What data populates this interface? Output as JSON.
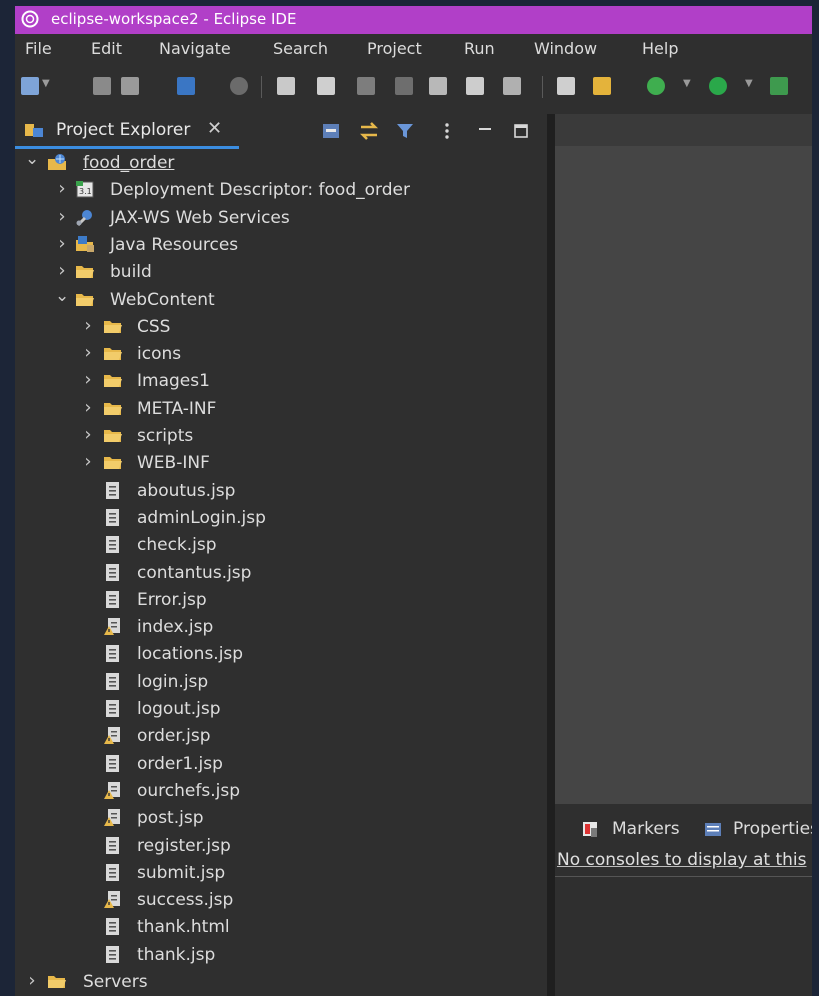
{
  "window": {
    "title": "eclipse-workspace2 - Eclipse IDE"
  },
  "menu": [
    {
      "key": "F",
      "rest": "ile"
    },
    {
      "key": "E",
      "rest": "dit"
    },
    {
      "key": "N",
      "rest": "avigate"
    },
    {
      "key": "Se",
      "rest": "a",
      "tail": "rch",
      "mode": "mid"
    },
    {
      "key": "P",
      "rest": "roject"
    },
    {
      "key": "R",
      "rest": "un"
    },
    {
      "key": "W",
      "rest": "indow"
    },
    {
      "key": "H",
      "rest": "elp"
    }
  ],
  "menu_labels": [
    "File",
    "Edit",
    "Navigate",
    "Search",
    "Project",
    "Run",
    "Window",
    "Help"
  ],
  "explorer": {
    "title": "Project Explorer",
    "close_glyph": "✕",
    "header_icons": [
      "collapse-all-icon",
      "link-with-editor-icon",
      "filter-icon",
      "view-menu-icon",
      "minimize-icon",
      "maximize-icon"
    ]
  },
  "tree": [
    {
      "label": "food_order",
      "depth": 0,
      "chev": "open",
      "icon": "project"
    },
    {
      "label": "Deployment Descriptor: food_order",
      "depth": 1,
      "chev": "closed",
      "icon": "descriptor"
    },
    {
      "label": "JAX-WS Web Services",
      "depth": 1,
      "chev": "closed",
      "icon": "webservices"
    },
    {
      "label": "Java Resources",
      "depth": 1,
      "chev": "closed",
      "icon": "javares"
    },
    {
      "label": "build",
      "depth": 1,
      "chev": "closed",
      "icon": "folder"
    },
    {
      "label": "WebContent",
      "depth": 1,
      "chev": "open",
      "icon": "folder"
    },
    {
      "label": "CSS",
      "depth": 2,
      "chev": "closed",
      "icon": "folder"
    },
    {
      "label": "icons",
      "depth": 2,
      "chev": "closed",
      "icon": "folder"
    },
    {
      "label": "Images1",
      "depth": 2,
      "chev": "closed",
      "icon": "folder"
    },
    {
      "label": "META-INF",
      "depth": 2,
      "chev": "closed",
      "icon": "folder"
    },
    {
      "label": "scripts",
      "depth": 2,
      "chev": "closed",
      "icon": "folder"
    },
    {
      "label": "WEB-INF",
      "depth": 2,
      "chev": "closed",
      "icon": "folder"
    },
    {
      "label": "aboutus.jsp",
      "depth": 2,
      "chev": "none",
      "icon": "file"
    },
    {
      "label": "adminLogin.jsp",
      "depth": 2,
      "chev": "none",
      "icon": "file"
    },
    {
      "label": "check.jsp",
      "depth": 2,
      "chev": "none",
      "icon": "file"
    },
    {
      "label": "contantus.jsp",
      "depth": 2,
      "chev": "none",
      "icon": "file"
    },
    {
      "label": "Error.jsp",
      "depth": 2,
      "chev": "none",
      "icon": "file"
    },
    {
      "label": "index.jsp",
      "depth": 2,
      "chev": "none",
      "icon": "file-warning"
    },
    {
      "label": "locations.jsp",
      "depth": 2,
      "chev": "none",
      "icon": "file"
    },
    {
      "label": "login.jsp",
      "depth": 2,
      "chev": "none",
      "icon": "file"
    },
    {
      "label": "logout.jsp",
      "depth": 2,
      "chev": "none",
      "icon": "file"
    },
    {
      "label": "order.jsp",
      "depth": 2,
      "chev": "none",
      "icon": "file-warning"
    },
    {
      "label": "order1.jsp",
      "depth": 2,
      "chev": "none",
      "icon": "file"
    },
    {
      "label": "ourchefs.jsp",
      "depth": 2,
      "chev": "none",
      "icon": "file-warning"
    },
    {
      "label": "post.jsp",
      "depth": 2,
      "chev": "none",
      "icon": "file-warning"
    },
    {
      "label": "register.jsp",
      "depth": 2,
      "chev": "none",
      "icon": "file"
    },
    {
      "label": "submit.jsp",
      "depth": 2,
      "chev": "none",
      "icon": "file"
    },
    {
      "label": "success.jsp",
      "depth": 2,
      "chev": "none",
      "icon": "file-warning"
    },
    {
      "label": "thank.html",
      "depth": 2,
      "chev": "none",
      "icon": "file"
    },
    {
      "label": "thank.jsp",
      "depth": 2,
      "chev": "none",
      "icon": "file"
    },
    {
      "label": "Servers",
      "depth": 0,
      "chev": "closed",
      "icon": "folder"
    }
  ],
  "bottom": {
    "tabs": [
      {
        "label": "Markers",
        "icon": "markers-icon"
      },
      {
        "label": "Properties",
        "icon": "properties-icon"
      }
    ],
    "message": "No consoles to display at this"
  },
  "colors": {
    "titlebar": "#b13fc8",
    "background": "#2f2f2f",
    "editor": "#454545",
    "tab_accent": "#3b8de0",
    "folder": "#e7b84a"
  }
}
